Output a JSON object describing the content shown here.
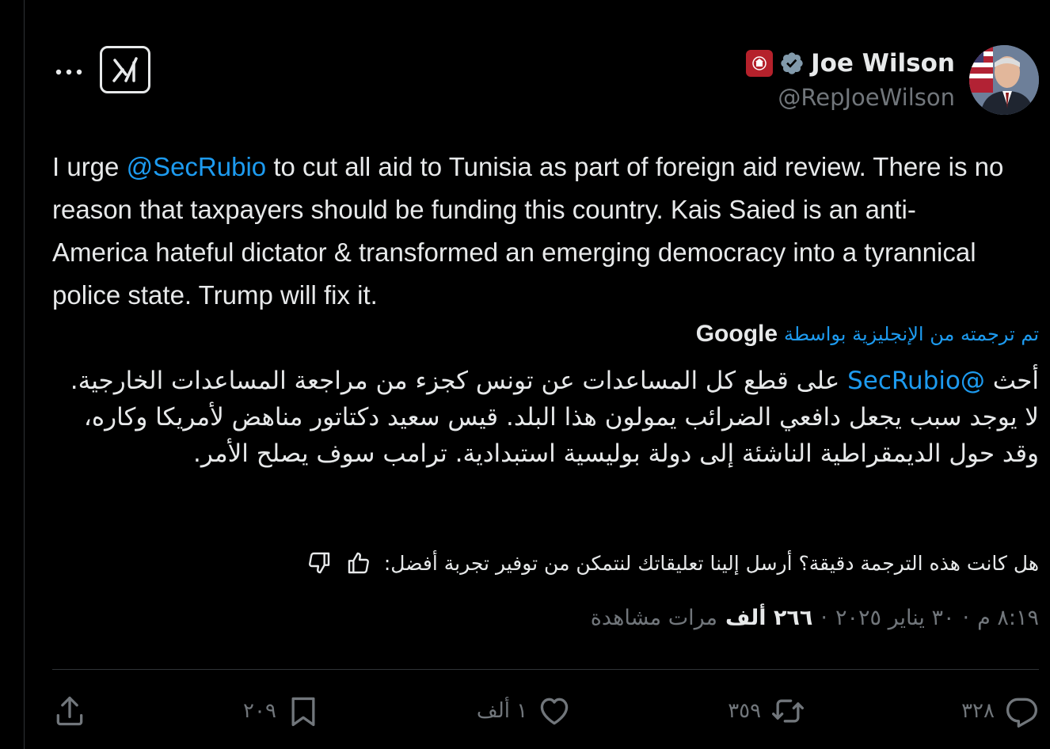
{
  "author": {
    "name": "Joe Wilson",
    "handle": "@RepJoeWilson"
  },
  "icons": {
    "more": "more-icon",
    "grok": "grok-icon",
    "verified": "verified-badge-icon",
    "affiliation": "affiliation-badge-icon",
    "like": "heart-icon",
    "reply": "reply-icon",
    "repost": "repost-icon",
    "bookmark": "bookmark-icon",
    "share": "share-icon",
    "thumbs_up": "thumbs-up-icon",
    "thumbs_down": "thumbs-down-icon"
  },
  "colors": {
    "accent": "#1d9bf0",
    "background": "#000000",
    "secondary_text": "#71767b",
    "verified": "#829aab",
    "affiliation": "#b5212b"
  },
  "tweet": {
    "en_before": "I urge ",
    "en_mention": "@SecRubio",
    "en_after": " to cut all aid to Tunisia as part of foreign aid review. There is no reason that taxpayers should be funding this country. Kais Saied is an anti-America hateful dictator & transformed an emerging democracy into a tyrannical police state. Trump will fix it.",
    "translated_label": "تم ترجمته من الإنجليزية بواسطة",
    "translator": "Google",
    "ar_before": "أحث ",
    "ar_mention": "@SecRubio",
    "ar_after": " على قطع كل المساعدات عن تونس كجزء من مراجعة المساعدات الخارجية. لا يوجد سبب يجعل دافعي الضرائب يمولون هذا البلد. قيس سعيد دكتاتور مناهض لأمريكا وكاره، وقد حول الديمقراطية الناشئة إلى دولة بوليسية استبدادية. ترامب سوف يصلح الأمر.",
    "feedback_prompt": "هل كانت هذه الترجمة دقيقة؟ أرسل إلينا تعليقاتك لنتمكن من توفير تجربة أفضل:"
  },
  "meta": {
    "time": "٨:١٩ م",
    "sep": "·",
    "date": "٣٠ يناير ٢٠٢٥",
    "views": "٢٦٦ ألف",
    "views_label": "مرات مشاهدة"
  },
  "actions": {
    "replies": "٣٢٨",
    "reposts": "٣٥٩",
    "likes": "١ ألف",
    "bookmarks": "٢٠٩"
  }
}
